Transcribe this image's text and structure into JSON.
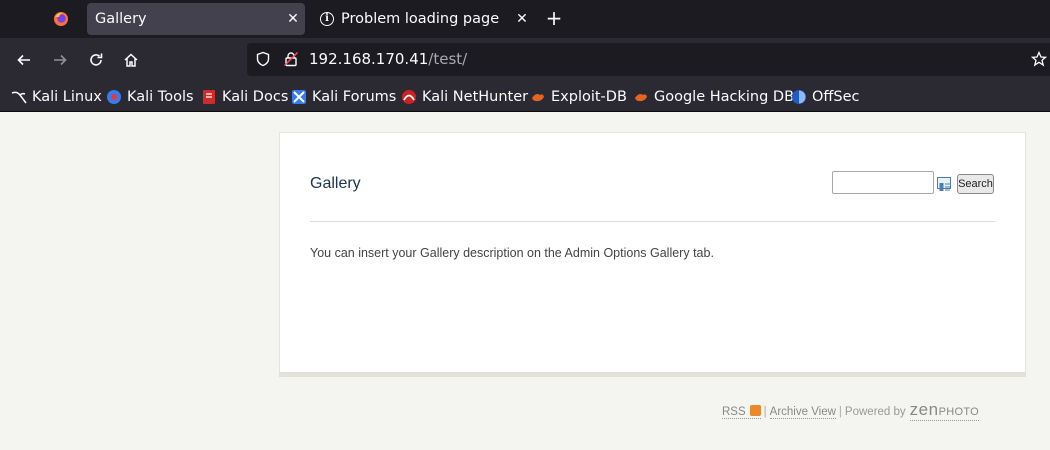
{
  "browser": {
    "tabs": [
      {
        "title": "Gallery",
        "active": true
      },
      {
        "title": "Problem loading page",
        "active": false
      }
    ],
    "url": {
      "host": "192.168.170.41",
      "path": "/test/"
    },
    "bookmarks": [
      {
        "label": "Kali Linux",
        "icon": "kali-dragon-icon"
      },
      {
        "label": "Kali Tools",
        "icon": "kali-tools-icon"
      },
      {
        "label": "Kali Docs",
        "icon": "kali-docs-icon"
      },
      {
        "label": "Kali Forums",
        "icon": "kali-forums-icon"
      },
      {
        "label": "Kali NetHunter",
        "icon": "kali-nethunter-icon"
      },
      {
        "label": "Exploit-DB",
        "icon": "exploit-db-icon"
      },
      {
        "label": "Google Hacking DB",
        "icon": "ghdb-icon"
      },
      {
        "label": "OffSec",
        "icon": "offsec-icon"
      }
    ],
    "colors": {
      "tabbar": "#1c1b22",
      "toolbar": "#2b2a33",
      "active_tab": "#42414d"
    }
  },
  "page": {
    "title": "Gallery",
    "search": {
      "value": "",
      "button_label": "Search"
    },
    "description": "You can insert your Gallery description on the Admin Options Gallery tab.",
    "footer": {
      "rss_label": "RSS",
      "archive_label": "Archive View",
      "powered_by": "Powered by",
      "logo_zen": "zen",
      "logo_photo": "PHOTO",
      "separator": "|"
    }
  }
}
